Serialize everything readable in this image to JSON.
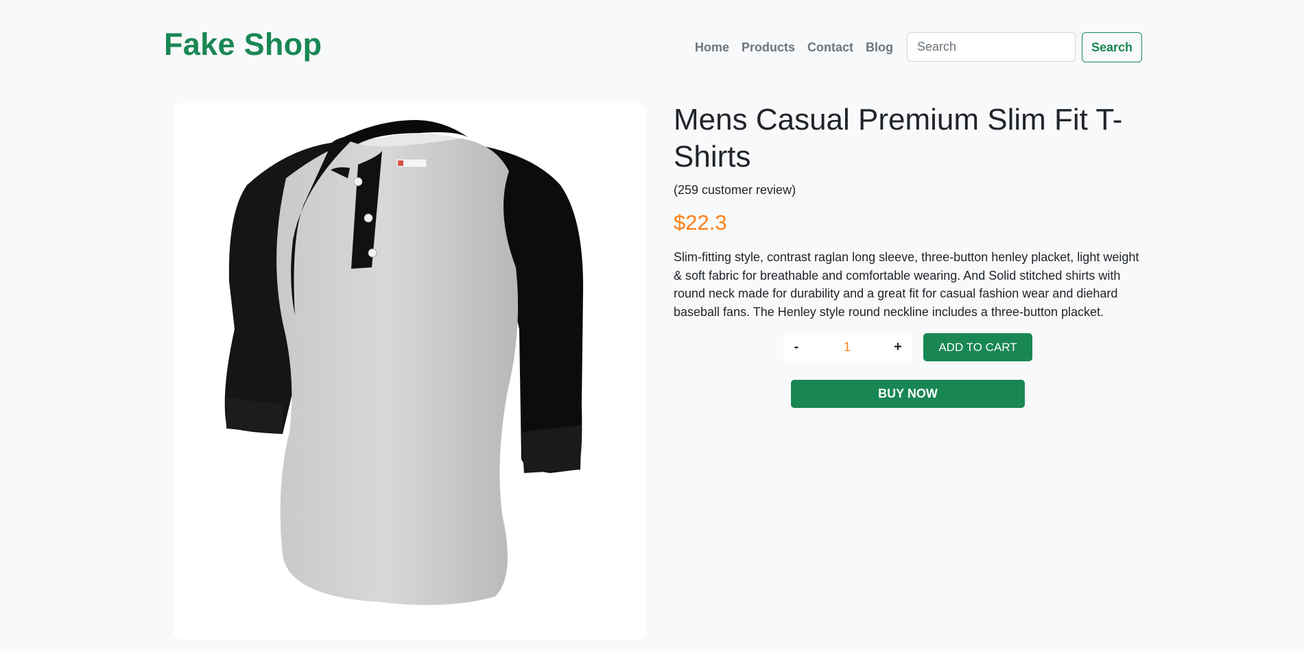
{
  "header": {
    "brand": "Fake Shop",
    "nav": [
      {
        "label": "Home"
      },
      {
        "label": "Products"
      },
      {
        "label": "Contact"
      },
      {
        "label": "Blog"
      }
    ],
    "search": {
      "placeholder": "Search",
      "value": "",
      "button_label": "Search"
    }
  },
  "product": {
    "title": "Mens Casual Premium Slim Fit T-Shirts",
    "reviews": "(259 customer review)",
    "price": "$22.3",
    "description": "Slim-fitting style, contrast raglan long sleeve, three-button henley placket, light weight & soft fabric for breathable and comfortable wearing. And Solid stitched shirts with round neck made for durability and a great fit for casual fashion wear and diehard baseball fans. The Henley style round neckline includes a three-button placket.",
    "image_alt": "Mens Casual Premium Slim Fit T-Shirts",
    "quantity": {
      "minus_label": "-",
      "value": "1",
      "plus_label": "+"
    },
    "add_to_cart_label": "ADD TO CART",
    "buy_now_label": "BUY NOW"
  },
  "colors": {
    "brand_green": "#198754",
    "price_orange": "#fd7e14",
    "page_background": "#f8f9fa"
  },
  "icons": [
    "product-image"
  ]
}
